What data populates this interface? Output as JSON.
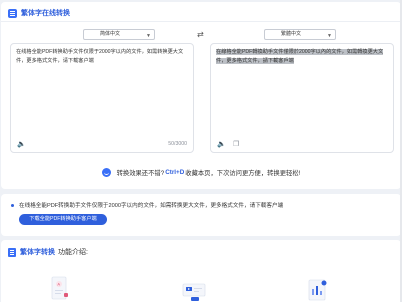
{
  "header": {
    "title": "繁体字在线转换",
    "icon": "doc-list-icon"
  },
  "selectors": {
    "source": {
      "value": "简体中文"
    },
    "target": {
      "value": "繁體中文"
    },
    "swap_icon": "swap-icon"
  },
  "input_panel": {
    "text": "在线格全能PDF转换助手文件仅限于2000字以内的文件，如需转换更大文件，更多格式文件，请下载客户端",
    "char_count": "50/3000"
  },
  "output_panel": {
    "text": "在線格全能PDF轉換助手文件僅限於2000字以內的文件，如需轉換更大文件，更多格式文件，請下載客戶端"
  },
  "promo": {
    "prefix": "转换效果还不错?",
    "shortcut": "Ctrl+D",
    "suffix": "收藏本页，下次访问更方便，转换更轻松!"
  },
  "notice": {
    "text": "在线格全能PDF转换助手文件仅限于2000字以内的文件，如需转换更大文件，更多格式文件，请下载客户端",
    "button_label": "下载全能PDF转换助手客户端"
  },
  "features": {
    "title": "繁体字转换",
    "subtitle": "功能介绍:"
  },
  "colors": {
    "accent": "#2f5fdc",
    "page_bg": "#eef1f6"
  }
}
